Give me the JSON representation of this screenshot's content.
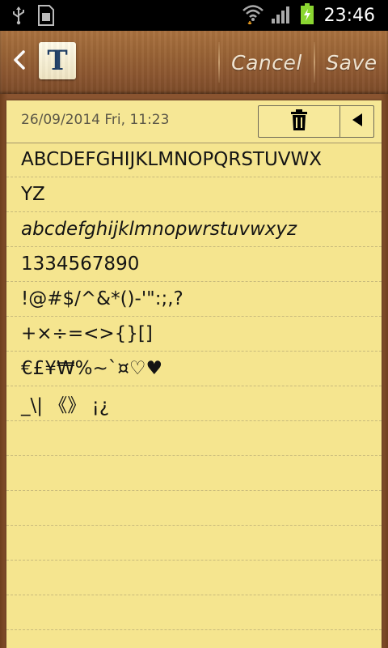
{
  "status_bar": {
    "time": "23:46",
    "icons": [
      "usb-icon",
      "sd-card-icon",
      "wifi-icon",
      "signal-icon",
      "battery-charging-icon"
    ]
  },
  "header": {
    "back_icon": "chevron-left-icon",
    "font_button_label": "T",
    "cancel_label": "Cancel",
    "save_label": "Save"
  },
  "note": {
    "date": "26/09/2014 Fri, 11:23",
    "tools": [
      "trash-icon",
      "triangle-left-icon"
    ],
    "lines": [
      "ABCDEFGHIJKLMNOPQRSTUVWX",
      "YZ",
      "abcdefghijklmnopwrstuvwxyz",
      "1334567890",
      "!@#$/^&*()-'\":;,?",
      "+×÷=<>{}[]",
      "€£¥₩%~`¤♡♥",
      "_\\| 《》 ¡¿",
      "",
      "",
      "",
      "",
      "",
      "",
      ""
    ]
  },
  "colors": {
    "paper": "#f5e58f",
    "wood": "#9a6436",
    "text": "#141414"
  }
}
